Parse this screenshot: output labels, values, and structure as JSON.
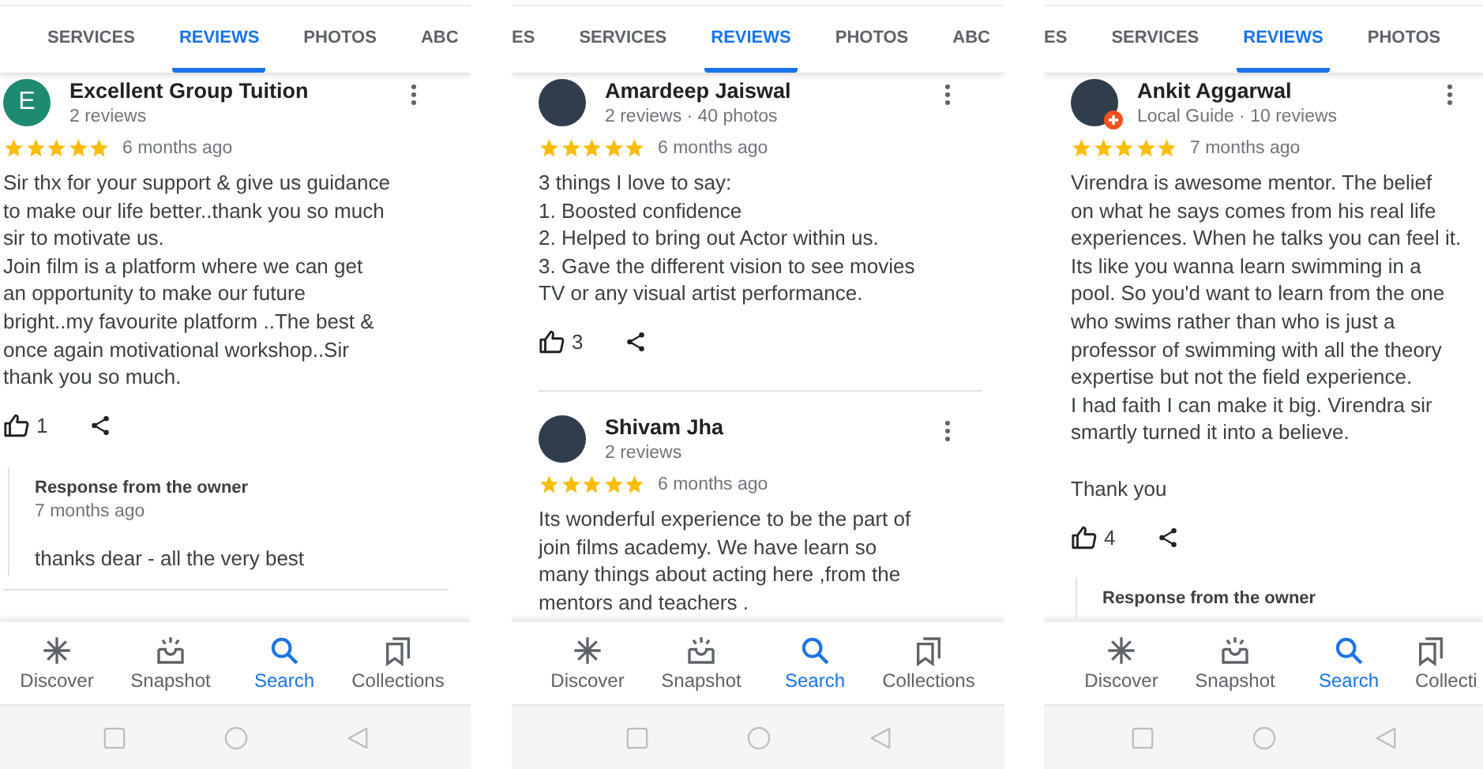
{
  "screens": [
    {
      "tabs": [
        {
          "label": "SERVICES",
          "selected": false
        },
        {
          "label": "REVIEWS",
          "selected": true
        },
        {
          "label": "PHOTOS",
          "selected": false
        },
        {
          "label": "ABC",
          "selected": false
        }
      ],
      "reviews": [
        {
          "avatar": {
            "kind": "letter",
            "letter": "E"
          },
          "name": "Excellent Group Tuition",
          "meta": "2 reviews",
          "stars": 5,
          "time": "6 months ago",
          "text": "Sir thx for your support & give us guidance\nto make our life better..thank you so much\nsir to motivate us.\nJoin film is a platform where we can get\nan opportunity to make our future\nbright..my favourite platform ..The best &\nonce again motivational workshop..Sir\nthank you so much.",
          "likes": "1",
          "response": {
            "title": "Response from the owner",
            "time": "7 months ago",
            "text": "thanks dear - all the very best"
          }
        }
      ],
      "nav": [
        {
          "label": "Discover",
          "selected": false
        },
        {
          "label": "Snapshot",
          "selected": false
        },
        {
          "label": "Search",
          "selected": true
        },
        {
          "label": "Collections",
          "selected": false
        }
      ]
    },
    {
      "tabs": [
        {
          "label": "ES",
          "selected": false
        },
        {
          "label": "SERVICES",
          "selected": false
        },
        {
          "label": "REVIEWS",
          "selected": true
        },
        {
          "label": "PHOTOS",
          "selected": false
        },
        {
          "label": "ABC",
          "selected": false
        }
      ],
      "reviews": [
        {
          "avatar": {
            "kind": "photo"
          },
          "name": "Amardeep Jaiswal",
          "meta": "2 reviews · 40 photos",
          "stars": 5,
          "time": "6 months ago",
          "text": "3 things I love to say:\n1. Boosted confidence\n2. Helped to bring out Actor within us.\n3. Gave the different vision to see movies\nTV or any visual artist performance.",
          "likes": "3"
        },
        {
          "avatar": {
            "kind": "photo"
          },
          "name": "Shivam Jha",
          "meta": "2 reviews",
          "stars": 5,
          "time": "6 months ago",
          "text": "Its wonderful experience to be the part of\njoin films academy. We have learn so\nmany things about acting here ,from the\nmentors and teachers ."
        }
      ],
      "nav": [
        {
          "label": "Discover",
          "selected": false
        },
        {
          "label": "Snapshot",
          "selected": false
        },
        {
          "label": "Search",
          "selected": true
        },
        {
          "label": "Collections",
          "selected": false
        }
      ]
    },
    {
      "tabs": [
        {
          "label": "ES",
          "selected": false
        },
        {
          "label": "SERVICES",
          "selected": false
        },
        {
          "label": "REVIEWS",
          "selected": true
        },
        {
          "label": "PHOTOS",
          "selected": false
        }
      ],
      "reviews": [
        {
          "avatar": {
            "kind": "photo",
            "local_guide": true
          },
          "name": "Ankit Aggarwal",
          "meta": "Local Guide · 10 reviews",
          "stars": 5,
          "time": "7 months ago",
          "text": "Virendra is awesome mentor. The belief\non what he says comes from his real life\nexperiences. When he talks you can feel it.\nIts like you wanna learn swimming in a\npool. So you'd want to learn from the one\nwho swims rather than who is just a\nprofessor of swimming with all the theory\nexpertise but not the field experience.\nI had faith I can make it big. Virendra sir\nsmartly turned it into a believe.\n\nThank you",
          "likes": "4",
          "response": {
            "title": "Response from the owner"
          }
        }
      ],
      "nav": [
        {
          "label": "Discover",
          "selected": false
        },
        {
          "label": "Snapshot",
          "selected": false
        },
        {
          "label": "Search",
          "selected": true
        },
        {
          "label": "Collecti",
          "selected": false
        }
      ]
    }
  ]
}
